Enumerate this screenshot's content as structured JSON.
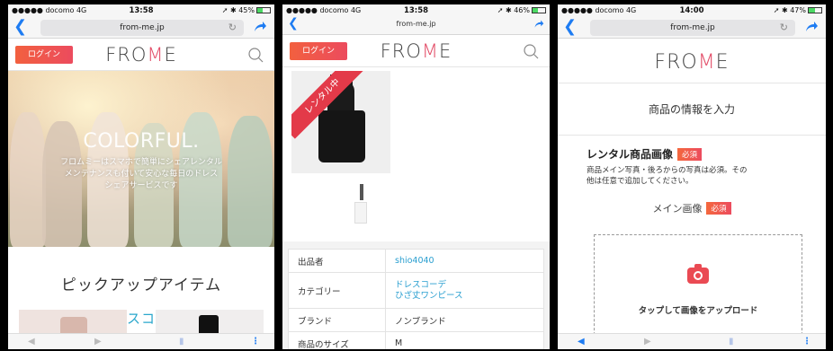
{
  "phones": [
    {
      "status": {
        "carrier": "●●●●● docomo 4G",
        "time": "13:58",
        "right": "➚ ✱ 45%",
        "battery_level": 0.45
      },
      "url": "from-me.jp",
      "login_label": "ログイン",
      "logo": {
        "prefix": "FRO",
        "m": "M",
        "suffix": "E"
      },
      "hero": {
        "headline": "COLORFUL.",
        "tagline_line1": "フロムミーはスマホで簡単にシェアレンタル",
        "tagline_line2": "メンテナンスも付いて安心な毎日のドレス",
        "tagline_line3": "シェアサービスです"
      },
      "pickup_title": "ピックアップアイテム",
      "pickup_category": "ドレスコーデ"
    },
    {
      "status": {
        "carrier": "●●●●● docomo 4G",
        "time": "13:58",
        "right": "➚ ✱ 46%",
        "battery_level": 0.46
      },
      "url": "from-me.jp",
      "login_label": "ログイン",
      "logo": {
        "prefix": "FRO",
        "m": "M",
        "suffix": "E"
      },
      "ribbon": "レンタル中",
      "details": [
        {
          "key": "出品者",
          "value": "shio4040",
          "link": true
        },
        {
          "key": "カテゴリー",
          "value_line1": "ドレスコーデ",
          "value_line2": "ひざ丈ワンピース",
          "link": true
        },
        {
          "key": "ブランド",
          "value": "ノンブランド",
          "link": false
        },
        {
          "key": "商品のサイズ",
          "value": "M",
          "link": false
        }
      ]
    },
    {
      "status": {
        "carrier": "●●●●● docomo 4G",
        "time": "14:00",
        "right": "➚ ✱ 47%",
        "battery_level": 0.47
      },
      "url": "from-me.jp",
      "logo": {
        "prefix": "FRO",
        "m": "M",
        "suffix": "E"
      },
      "form_heading": "商品の情報を入力",
      "section_title": "レンタル商品画像",
      "required_badge": "必須",
      "note_line1": "商品メイン写真・後ろからの写真は必須。その",
      "note_line2": "他は任意で追加してください。",
      "main_image_label": "メイン画像",
      "upload_text": "タップして画像をアップロード"
    }
  ],
  "colors": {
    "accent": "#ec4b5e",
    "link": "#2a9fd0",
    "ios_blue": "#1e7cf2"
  },
  "icons": [
    "back-arrow-icon",
    "reload-icon",
    "share-icon",
    "search-icon",
    "camera-icon",
    "bookmarks-icon",
    "more-icon"
  ]
}
